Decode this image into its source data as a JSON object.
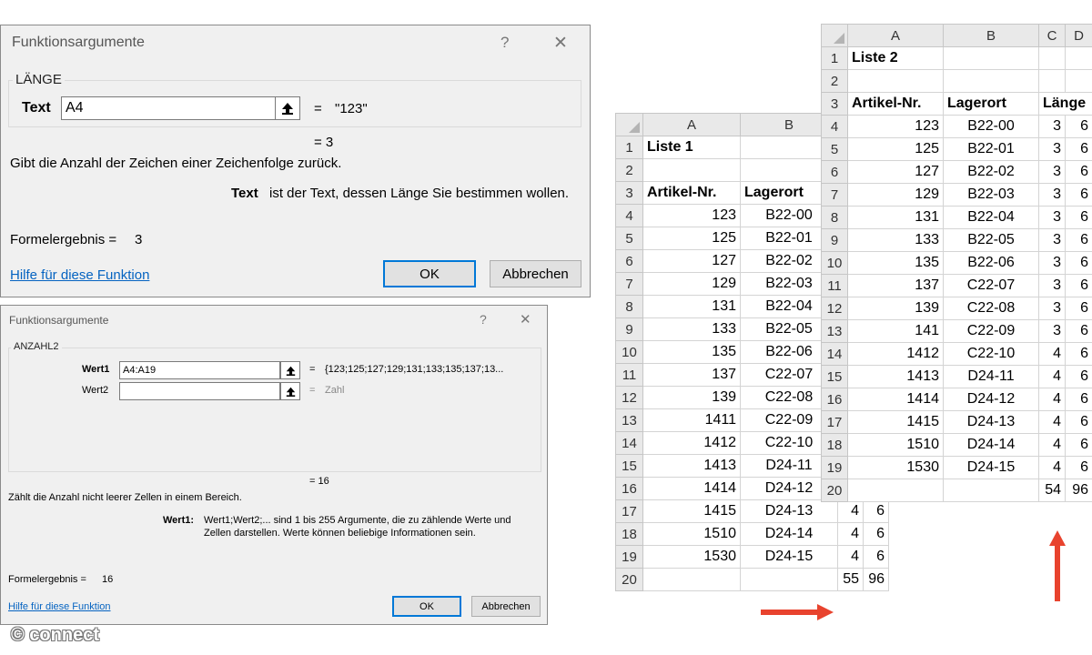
{
  "dialog1": {
    "title": "Funktionsargumente",
    "help_glyph": "?",
    "close_glyph": "✕",
    "function_name": "LÄNGE",
    "arg_label": "Text",
    "arg_value": "A4",
    "arg_equals": "=",
    "arg_result": "\"123\"",
    "result_line": "=  3",
    "description": "Gibt die Anzahl der Zeichen einer Zeichenfolge zurück.",
    "param_name": "Text",
    "param_desc": "ist der Text, dessen Länge Sie bestimmen wollen.",
    "formula_result_label": "Formelergebnis =",
    "formula_result_value": "3",
    "help_link": "Hilfe für diese Funktion",
    "ok": "OK",
    "cancel": "Abbrechen"
  },
  "dialog2": {
    "title": "Funktionsargumente",
    "help_glyph": "?",
    "close_glyph": "✕",
    "function_name": "ANZAHL2",
    "arg1_label": "Wert1",
    "arg1_value": "A4:A19",
    "arg1_equals": "=",
    "arg1_result": "{123;125;127;129;131;133;135;137;13...",
    "arg2_label": "Wert2",
    "arg2_value": "",
    "arg2_equals": "=",
    "arg2_result": "Zahl",
    "result_line": "=  16",
    "description": "Zählt die Anzahl nicht leerer Zellen in einem Bereich.",
    "param_name": "Wert1:",
    "param_desc_1": "Wert1;Wert2;... sind 1 bis 255 Argumente, die zu zählende Werte und",
    "param_desc_2": "Zellen darstellen. Werte können beliebige Informationen sein.",
    "formula_result_label": "Formelergebnis =",
    "formula_result_value": "16",
    "help_link": "Hilfe für diese Funktion",
    "ok": "OK",
    "cancel": "Abbrechen"
  },
  "sheet1": {
    "columns": [
      "A",
      "B"
    ],
    "title": "Liste 1",
    "header_a": "Artikel-Nr.",
    "header_b": "Lagerort",
    "rows": [
      {
        "a": "123",
        "b": "B22-00",
        "c": "",
        "d": ""
      },
      {
        "a": "125",
        "b": "B22-01",
        "c": "",
        "d": ""
      },
      {
        "a": "127",
        "b": "B22-02",
        "c": "",
        "d": ""
      },
      {
        "a": "129",
        "b": "B22-03",
        "c": "",
        "d": ""
      },
      {
        "a": "131",
        "b": "B22-04",
        "c": "",
        "d": ""
      },
      {
        "a": "133",
        "b": "B22-05",
        "c": "",
        "d": ""
      },
      {
        "a": "135",
        "b": "B22-06",
        "c": "",
        "d": ""
      },
      {
        "a": "137",
        "b": "C22-07",
        "c": "",
        "d": ""
      },
      {
        "a": "139",
        "b": "C22-08",
        "c": "",
        "d": ""
      },
      {
        "a": "1411",
        "b": "C22-09",
        "c": "",
        "d": ""
      },
      {
        "a": "1412",
        "b": "C22-10",
        "c": "",
        "d": ""
      },
      {
        "a": "1413",
        "b": "D24-11",
        "c": "",
        "d": ""
      },
      {
        "a": "1414",
        "b": "D24-12",
        "c": "",
        "d": ""
      },
      {
        "a": "1415",
        "b": "D24-13",
        "c": "4",
        "d": "6"
      },
      {
        "a": "1510",
        "b": "D24-14",
        "c": "4",
        "d": "6"
      },
      {
        "a": "1530",
        "b": "D24-15",
        "c": "4",
        "d": "6"
      }
    ],
    "total_c": "55",
    "total_d": "96"
  },
  "sheet2": {
    "columns": [
      "A",
      "B",
      "C",
      "D"
    ],
    "title": "Liste 2",
    "header_a": "Artikel-Nr.",
    "header_b": "Lagerort",
    "header_c": "Länge",
    "rows": [
      {
        "a": "123",
        "b": "B22-00",
        "c": "3",
        "d": "6"
      },
      {
        "a": "125",
        "b": "B22-01",
        "c": "3",
        "d": "6"
      },
      {
        "a": "127",
        "b": "B22-02",
        "c": "3",
        "d": "6"
      },
      {
        "a": "129",
        "b": "B22-03",
        "c": "3",
        "d": "6"
      },
      {
        "a": "131",
        "b": "B22-04",
        "c": "3",
        "d": "6"
      },
      {
        "a": "133",
        "b": "B22-05",
        "c": "3",
        "d": "6"
      },
      {
        "a": "135",
        "b": "B22-06",
        "c": "3",
        "d": "6"
      },
      {
        "a": "137",
        "b": "C22-07",
        "c": "3",
        "d": "6"
      },
      {
        "a": "139",
        "b": "C22-08",
        "c": "3",
        "d": "6"
      },
      {
        "a": "141",
        "b": "C22-09",
        "c": "3",
        "d": "6"
      },
      {
        "a": "1412",
        "b": "C22-10",
        "c": "4",
        "d": "6"
      },
      {
        "a": "1413",
        "b": "D24-11",
        "c": "4",
        "d": "6"
      },
      {
        "a": "1414",
        "b": "D24-12",
        "c": "4",
        "d": "6"
      },
      {
        "a": "1415",
        "b": "D24-13",
        "c": "4",
        "d": "6"
      },
      {
        "a": "1510",
        "b": "D24-14",
        "c": "4",
        "d": "6"
      },
      {
        "a": "1530",
        "b": "D24-15",
        "c": "4",
        "d": "6"
      }
    ],
    "total_c": "54",
    "total_d": "96"
  },
  "watermark": "© connect",
  "colors": {
    "arrow": "#e8432e",
    "ok_border": "#0078d7",
    "link": "#0563c1"
  },
  "icons": {
    "collapse": "collapse-dialog-icon"
  }
}
